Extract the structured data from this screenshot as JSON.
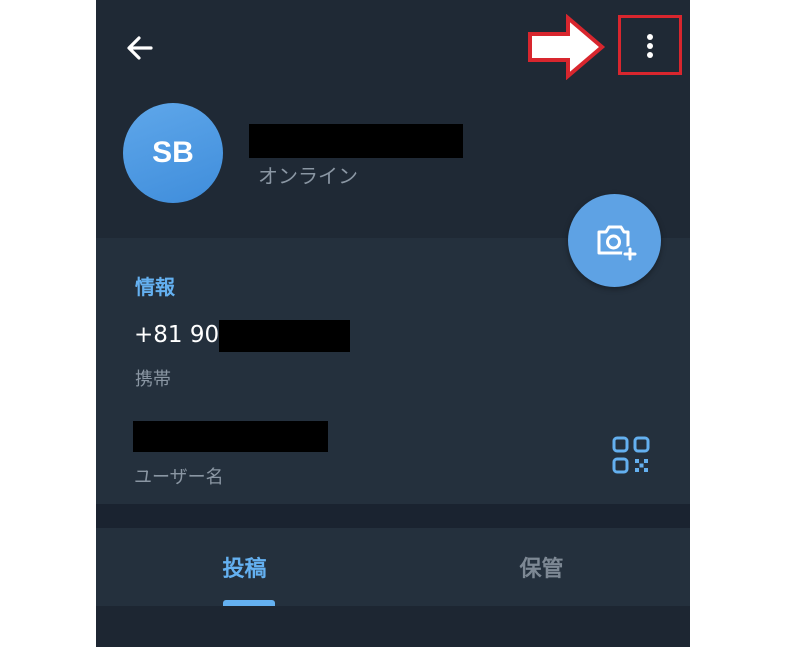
{
  "profile": {
    "avatar_initials": "SB",
    "status": "オンライン"
  },
  "info": {
    "section_title": "情報",
    "phone_prefix": "+81 90",
    "phone_label": "携帯",
    "username_label": "ユーザー名"
  },
  "tabs": [
    {
      "label": "投稿",
      "active": true
    },
    {
      "label": "保管",
      "active": false
    }
  ],
  "icons": {
    "back": "arrow-left-icon",
    "menu": "more-vertical-icon",
    "camera": "camera-add-icon",
    "qr": "qr-code-icon",
    "annotation": "red-arrow-icon"
  },
  "colors": {
    "background": "#1f2935",
    "accent": "#64b0f0",
    "avatar": "#4f9be4",
    "annotation": "#d8262e"
  }
}
